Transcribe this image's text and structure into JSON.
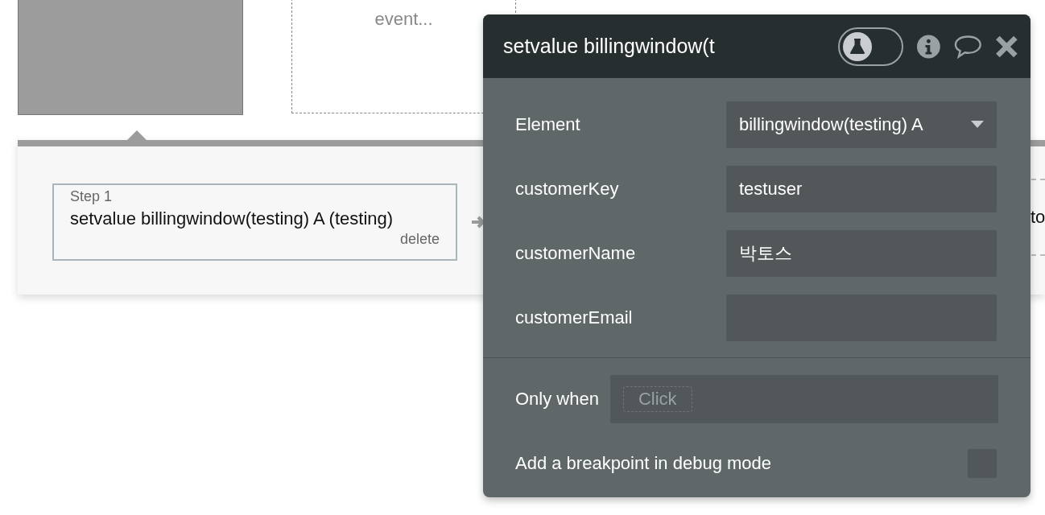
{
  "canvas": {
    "event_box": {
      "text": "event..."
    },
    "workflow": {
      "steps": [
        {
          "label": "Step 1",
          "action": "setvalue billingwindow(testing) A (testing)",
          "delete": "delete"
        }
      ],
      "next_step": {
        "text": "to"
      }
    }
  },
  "popup": {
    "title": "setvalue billingwindow(t",
    "debug_toggle": {
      "on": false
    },
    "fields": [
      {
        "label": "Element",
        "value": "billingwindow(testing) A",
        "kind": "dropdown"
      },
      {
        "label": "customerKey",
        "value": "testuser",
        "kind": "text"
      },
      {
        "label": "customerName",
        "value": "박토스",
        "kind": "text"
      },
      {
        "label": "customerEmail",
        "kind": "text"
      }
    ],
    "only_when": {
      "label": "Only when",
      "placeholder": "Click"
    },
    "breakpoint": {
      "label": "Add a breakpoint in debug mode",
      "checked": false
    }
  }
}
